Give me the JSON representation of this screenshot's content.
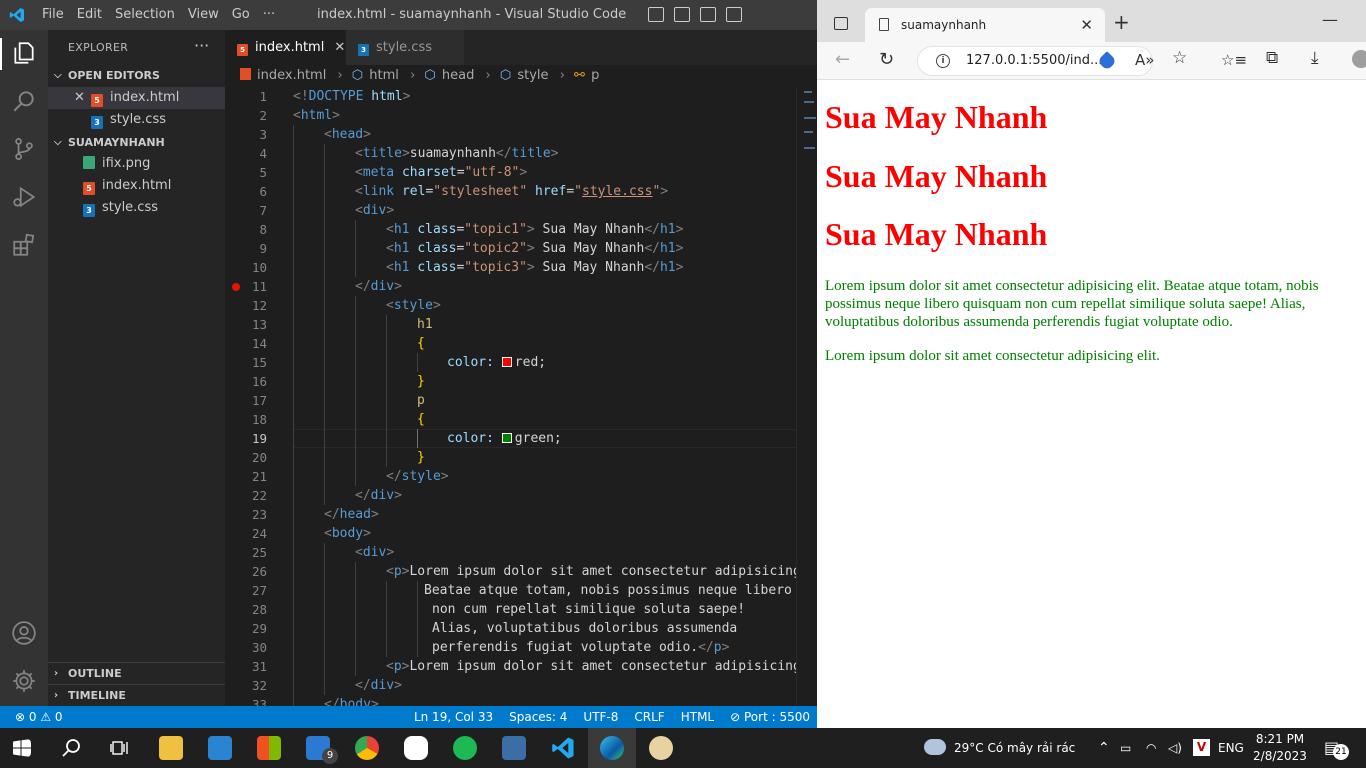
{
  "vscode": {
    "menu": [
      "File",
      "Edit",
      "Selection",
      "View",
      "Go",
      "···"
    ],
    "window_title": "index.html - suamaynhanh - Visual Studio Code",
    "sidebar": {
      "header": "EXPLORER",
      "header_more": "···",
      "open_editors_label": "OPEN EDITORS",
      "open_editors": [
        {
          "name": "index.html",
          "type": "html",
          "icon_text": "5"
        },
        {
          "name": "style.css",
          "type": "css",
          "icon_text": "3"
        }
      ],
      "folder_label": "SUAMAYNHANH",
      "files": [
        {
          "name": "ifix.png",
          "type": "png",
          "icon_text": ""
        },
        {
          "name": "index.html",
          "type": "html",
          "icon_text": "5"
        },
        {
          "name": "style.css",
          "type": "css",
          "icon_text": "3"
        }
      ],
      "outline_label": "OUTLINE",
      "timeline_label": "TIMELINE"
    },
    "tabs": [
      {
        "label": "index.html",
        "type": "html",
        "icon_text": "5",
        "active": true,
        "close": "✕"
      },
      {
        "label": "style.css",
        "type": "css",
        "icon_text": "3",
        "active": false
      }
    ],
    "breadcrumb": [
      "index.html",
      "html",
      "head",
      "style",
      "p"
    ],
    "code_lines": [
      {
        "n": "1"
      },
      {
        "n": "2"
      },
      {
        "n": "3"
      },
      {
        "n": "4"
      },
      {
        "n": "5"
      },
      {
        "n": "6"
      },
      {
        "n": "7"
      },
      {
        "n": "8"
      },
      {
        "n": "9"
      },
      {
        "n": "10"
      },
      {
        "n": "11"
      },
      {
        "n": "12"
      },
      {
        "n": "13"
      },
      {
        "n": "14"
      },
      {
        "n": "15"
      },
      {
        "n": "16"
      },
      {
        "n": "17"
      },
      {
        "n": "18"
      },
      {
        "n": "19"
      },
      {
        "n": "20"
      },
      {
        "n": "21"
      },
      {
        "n": "22"
      },
      {
        "n": "23"
      },
      {
        "n": "24"
      },
      {
        "n": "25"
      },
      {
        "n": "26"
      },
      {
        "n": "27"
      },
      {
        "n": "28"
      },
      {
        "n": "29"
      },
      {
        "n": "30"
      },
      {
        "n": "31"
      },
      {
        "n": "32"
      },
      {
        "n": "33"
      }
    ],
    "code": {
      "doctype": "DOCTYPE",
      "doctype_name": "html",
      "html": "html",
      "head": "head",
      "title_tag": "title",
      "title_text": "suamaynhanh",
      "meta": "meta",
      "charset_attr": "charset",
      "charset_val": "\"utf-8\"",
      "link": "link",
      "rel_attr": "rel",
      "rel_val": "\"stylesheet\"",
      "href_attr": "href",
      "href_val_q1": "\"",
      "href_val": "style.css",
      "href_val_q2": "\"",
      "div": "div",
      "h1": "h1",
      "class_attr": "class",
      "topic1": "\"topic1\"",
      "topic2": "\"topic2\"",
      "topic3": "\"topic3\"",
      "h1_text": " Sua May Nhanh",
      "style": "style",
      "sel_h1": "h1",
      "sel_p": "p",
      "brace_open": "{",
      "brace_close": "}",
      "prop_color": "color:",
      "val_red": "red;",
      "val_green": "green;",
      "body": "body",
      "p": "p",
      "p1_l1": "Lorem ipsum dolor sit amet consectetur adipisicing",
      "p1_l2": "Beatae atque totam, nobis possimus neque libero q",
      "p1_l3": "non cum repellat similique soluta saepe!",
      "p1_l4": "Alias, voluptatibus doloribus assumenda",
      "p1_l5": "perferendis fugiat voluptate odio.",
      "p2_l1": "Lorem ipsum dolor sit amet consectetur adipisicing"
    },
    "breakpoint_line": "11",
    "cursor_line": "19",
    "status": {
      "errors": "⊗ 0 ⚠ 0",
      "position": "Ln 19, Col 33",
      "spaces": "Spaces: 4",
      "encoding": "UTF-8",
      "eol": "CRLF",
      "language": "HTML",
      "port": "⊘ Port : 5500"
    },
    "colors": {
      "accent": "#007acc",
      "red_swatch": "#ff0000",
      "green_swatch": "#008000"
    }
  },
  "browser": {
    "tab_title": "suamaynhanh",
    "tab_close": "✕",
    "new_tab": "+",
    "minimize": "—",
    "back": "←",
    "refresh": "↻",
    "info_icon": "i",
    "url": "127.0.0.1:5500/ind...",
    "read_aloud": "A»",
    "fav_add": "☆",
    "favorites": "☆≡",
    "collections": "⧉",
    "download": "⤓",
    "page": {
      "headings": [
        "Sua May Nhanh",
        "Sua May Nhanh",
        "Sua May Nhanh"
      ],
      "paragraphs": [
        "Lorem ipsum dolor sit amet consectetur adipisicing elit. Beatae atque totam, nobis possimus neque libero quisquam non cum repellat similique soluta saepe! Alias, voluptatibus doloribus assumenda perferendis fugiat voluptate odio.",
        "Lorem ipsum dolor sit amet consectetur adipisicing elit."
      ]
    }
  },
  "taskbar": {
    "weather": "29°C  Có mây rải rác",
    "language": "ENG",
    "time": "8:21 PM",
    "date": "2/8/2023",
    "notifications": "21",
    "mail_badge": "9",
    "icons": [
      "start-icon",
      "search-icon",
      "task-view-icon",
      "file-explorer-icon",
      "photos-icon",
      "store-icon",
      "mail-icon",
      "chrome-icon",
      "zalo-icon",
      "spotify-icon",
      "sql-icon",
      "vscode-icon",
      "edge-icon",
      "paint-icon"
    ]
  }
}
